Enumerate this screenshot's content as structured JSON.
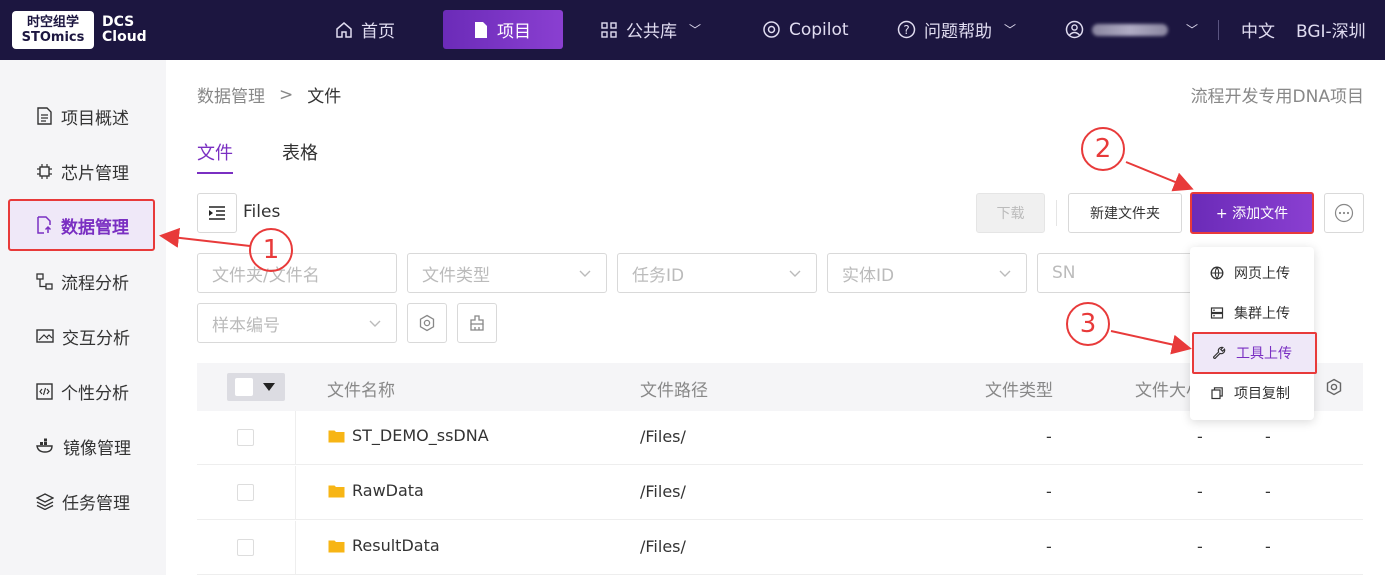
{
  "brand": {
    "logo_line1": "时空组学",
    "logo_line2": "STOmics",
    "product_line1": "DCS",
    "product_line2": "Cloud"
  },
  "nav": {
    "home": "首页",
    "project": "项目",
    "library": "公共库",
    "copilot": "Copilot",
    "help": "问题帮助",
    "language": "中文",
    "region": "BGI-深圳"
  },
  "sidebar": {
    "items": [
      {
        "label": "项目概述",
        "icon": "document-icon"
      },
      {
        "label": "芯片管理",
        "icon": "chip-icon"
      },
      {
        "label": "数据管理",
        "icon": "file-upload-icon"
      },
      {
        "label": "流程分析",
        "icon": "flow-icon"
      },
      {
        "label": "交互分析",
        "icon": "image-icon"
      },
      {
        "label": "个性分析",
        "icon": "code-icon"
      },
      {
        "label": "镜像管理",
        "icon": "docker-icon"
      },
      {
        "label": "任务管理",
        "icon": "layers-icon"
      }
    ]
  },
  "breadcrumb": {
    "parent": "数据管理",
    "separator": ">",
    "current": "文件"
  },
  "project_name": "流程开发专用DNA项目",
  "tabs": {
    "files": "文件",
    "tables": "表格"
  },
  "toolbar": {
    "folder_label": "Files",
    "download": "下载",
    "new_folder": "新建文件夹",
    "add_file": "+ 添加文件"
  },
  "filters": {
    "name_placeholder": "文件夹/文件名",
    "type_placeholder": "文件类型",
    "task_placeholder": "任务ID",
    "entity_placeholder": "实体ID",
    "sn_placeholder": "SN",
    "sample_placeholder": "样本编号"
  },
  "table": {
    "headers": {
      "name": "文件名称",
      "path": "文件路径",
      "type": "文件类型",
      "size": "文件大小"
    },
    "rows": [
      {
        "name": "ST_DEMO_ssDNA",
        "path": "/Files/",
        "type": "-",
        "size": "-",
        "extra": "-"
      },
      {
        "name": "RawData",
        "path": "/Files/",
        "type": "-",
        "size": "-",
        "extra": "-"
      },
      {
        "name": "ResultData",
        "path": "/Files/",
        "type": "-",
        "size": "-",
        "extra": "-"
      }
    ]
  },
  "add_menu": {
    "items": [
      {
        "label": "网页上传",
        "icon": "globe-icon"
      },
      {
        "label": "集群上传",
        "icon": "server-icon"
      },
      {
        "label": "工具上传",
        "icon": "wrench-icon"
      },
      {
        "label": "项目复制",
        "icon": "copy-icon"
      }
    ]
  },
  "annotations": {
    "step1": "1",
    "step2": "2",
    "step3": "3"
  },
  "colors": {
    "accent": "#7a2fc2",
    "topbar": "#1c1640",
    "highlight": "#e83a3a"
  }
}
